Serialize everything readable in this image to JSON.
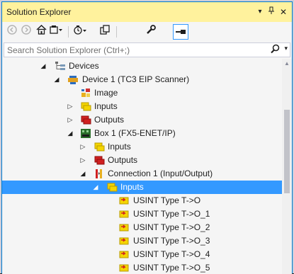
{
  "window": {
    "title": "Solution Explorer"
  },
  "title_buttons": {
    "dropdown": "▾",
    "pin": "ᵖ",
    "close": "✕"
  },
  "search": {
    "placeholder": "Search Solution Explorer (Ctrl+;)"
  },
  "tree": {
    "devices": "Devices",
    "device1": "Device 1 (TC3 EIP Scanner)",
    "image": "Image",
    "inputs": "Inputs",
    "outputs": "Outputs",
    "box1": "Box 1 (FX5-ENET/IP)",
    "box1_inputs": "Inputs",
    "box1_outputs": "Outputs",
    "connection1": "Connection 1 (Input/Output)",
    "conn_inputs": "Inputs",
    "vars": [
      "USINT Type T->O",
      "USINT Type T->O_1",
      "USINT Type T->O_2",
      "USINT Type T->O_3",
      "USINT Type T->O_4",
      "USINT Type T->O_5"
    ]
  },
  "colors": {
    "title_bg": "#fff29d",
    "selected_bg": "#3399ff",
    "border": "#007acc"
  }
}
